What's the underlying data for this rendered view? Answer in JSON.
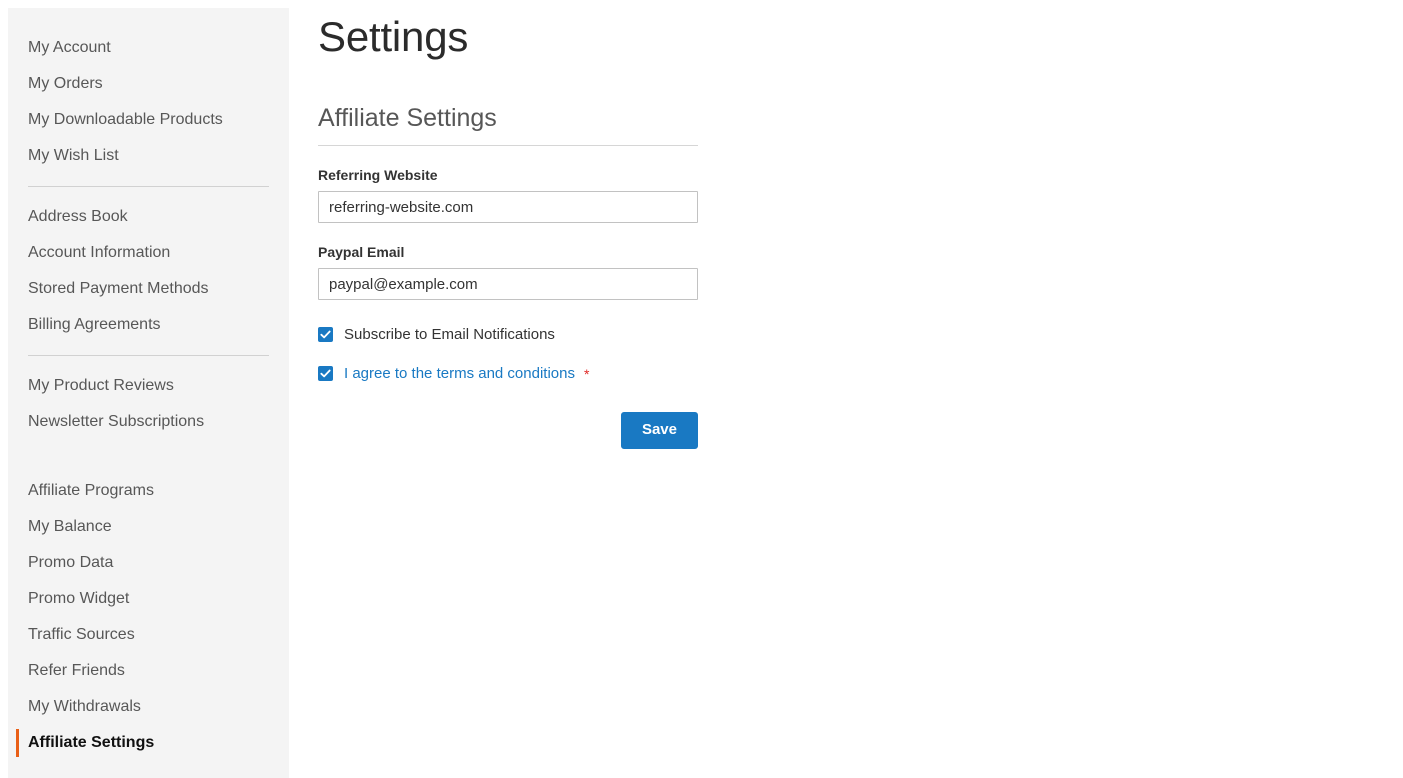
{
  "sidebar": {
    "groups": [
      {
        "items": [
          {
            "label": "My Account",
            "current": false
          },
          {
            "label": "My Orders",
            "current": false
          },
          {
            "label": "My Downloadable Products",
            "current": false
          },
          {
            "label": "My Wish List",
            "current": false
          }
        ],
        "separator_after": "divider"
      },
      {
        "items": [
          {
            "label": "Address Book",
            "current": false
          },
          {
            "label": "Account Information",
            "current": false
          },
          {
            "label": "Stored Payment Methods",
            "current": false
          },
          {
            "label": "Billing Agreements",
            "current": false
          }
        ],
        "separator_after": "divider"
      },
      {
        "items": [
          {
            "label": "My Product Reviews",
            "current": false
          },
          {
            "label": "Newsletter Subscriptions",
            "current": false
          }
        ],
        "separator_after": "gap"
      },
      {
        "items": [
          {
            "label": "Affiliate Programs",
            "current": false
          },
          {
            "label": "My Balance",
            "current": false
          },
          {
            "label": "Promo Data",
            "current": false
          },
          {
            "label": "Promo Widget",
            "current": false
          },
          {
            "label": "Traffic Sources",
            "current": false
          },
          {
            "label": "Refer Friends",
            "current": false
          },
          {
            "label": "My Withdrawals",
            "current": false
          },
          {
            "label": "Affiliate Settings",
            "current": true
          }
        ],
        "separator_after": "none"
      }
    ]
  },
  "main": {
    "page_title": "Settings",
    "legend": "Affiliate Settings",
    "fields": [
      {
        "name": "referring-website",
        "label": "Referring Website",
        "value": "referring-website.com",
        "placeholder": ""
      },
      {
        "name": "paypal-email",
        "label": "Paypal Email",
        "value": "paypal@example.com",
        "placeholder": ""
      }
    ],
    "checkboxes": [
      {
        "name": "subscribe-email-notifications",
        "label": "Subscribe to Email Notifications",
        "checked": true,
        "is_link": false,
        "required": false
      },
      {
        "name": "agree-terms-conditions",
        "label": "I agree to the terms and conditions",
        "checked": true,
        "is_link": true,
        "required": true,
        "required_mark": "*"
      }
    ],
    "save_label": "Save"
  },
  "colors": {
    "accent_blue": "#1979c3",
    "active_orange": "#e95f16",
    "required_red": "#e02b27",
    "sidebar_bg": "#f4f4f4",
    "text_default": "#575757",
    "text_strong": "#333333"
  }
}
